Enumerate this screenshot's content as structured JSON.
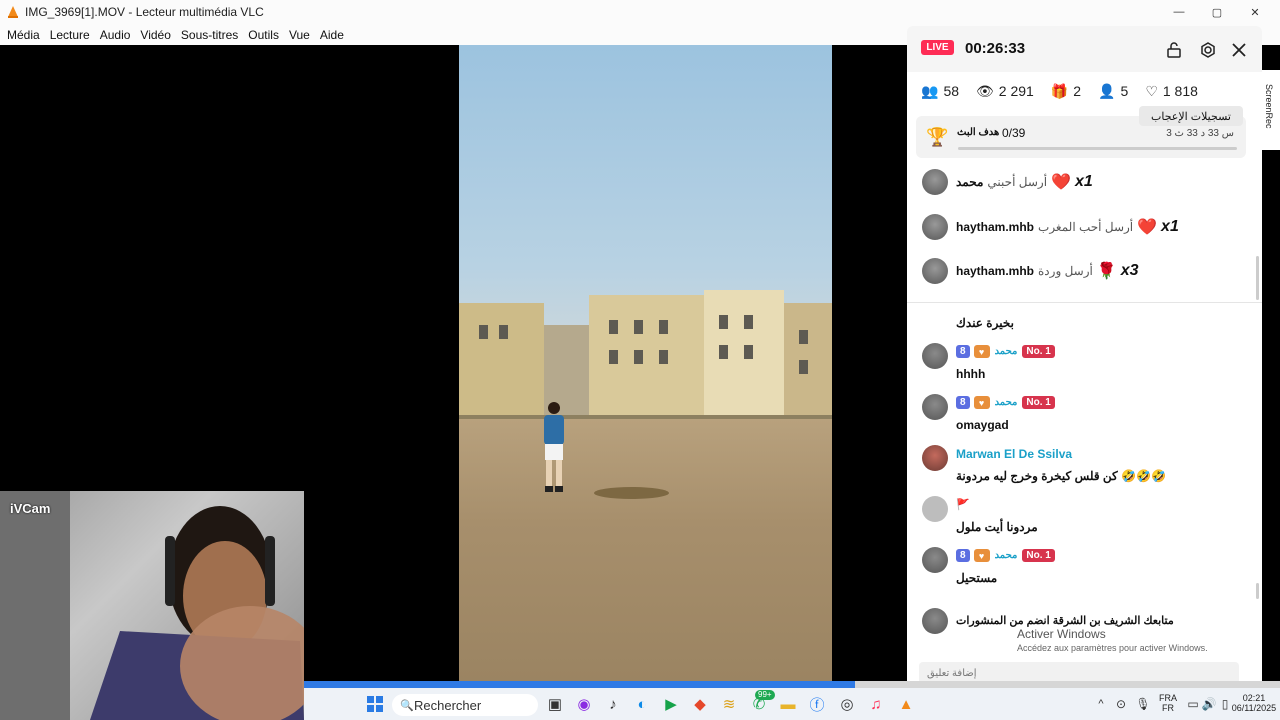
{
  "window": {
    "title": "IMG_3969[1].MOV - Lecteur multimédia VLC",
    "minimize": "—",
    "maximize": "▢",
    "close": "✕"
  },
  "menu": [
    "Média",
    "Lecture",
    "Audio",
    "Vidéo",
    "Sous-titres",
    "Outils",
    "Vue",
    "Aide"
  ],
  "webcam": {
    "label": "iVCam"
  },
  "live": {
    "badge": "LIVE",
    "timer": "00:26:33",
    "stats": {
      "viewers": "58",
      "views": "2 291",
      "gifts": "2",
      "followers": "5",
      "likes": "1 818"
    },
    "tooltip": "تسجيلات الإعجاب",
    "goal": {
      "label": "هدف البث",
      "value": "0/39",
      "time": "3 س 33 د 33 ث"
    },
    "gifts": [
      {
        "name": "محمد",
        "action": "أرسل أحبني",
        "count": "x1"
      },
      {
        "name": "haytham.mhb",
        "action": "أرسل أحب المغرب",
        "count": "x1"
      },
      {
        "name": "haytham.mhb",
        "action": "أرسل وردة",
        "count": "x3"
      }
    ],
    "messages": [
      {
        "text": "بخيرة عندك"
      },
      {
        "level": "8",
        "user": "محمد",
        "rank": "No. 1",
        "text": "hhhh"
      },
      {
        "level": "8",
        "user": "محمد",
        "rank": "No. 1",
        "text": "omaygad"
      },
      {
        "user": "Marwan El De Ssilva",
        "text": "كن قلس كيخرة وخرج ليه مردونة 🤣🤣🤣"
      },
      {
        "text": "مردونا أيت ملول"
      },
      {
        "level": "8",
        "user": "محمد",
        "rank": "No. 1",
        "text": "مستحيل"
      },
      {
        "text": "متابعك  الشريف بن الشرقة  انضم من المنشورات"
      }
    ],
    "input_placeholder": "إضافة تعليق",
    "side_label": "ScreenRec"
  },
  "windows_watermark": {
    "line1": "Activer Windows",
    "line2": "Accédez aux paramètres pour activer Windows."
  },
  "vlc": {
    "progress": 0.565
  },
  "taskbar": {
    "search_placeholder": "Rechercher",
    "badge": "99+",
    "lang1": "FRA",
    "lang2": "FR",
    "time": "02:21",
    "date": "06/11/2025"
  }
}
